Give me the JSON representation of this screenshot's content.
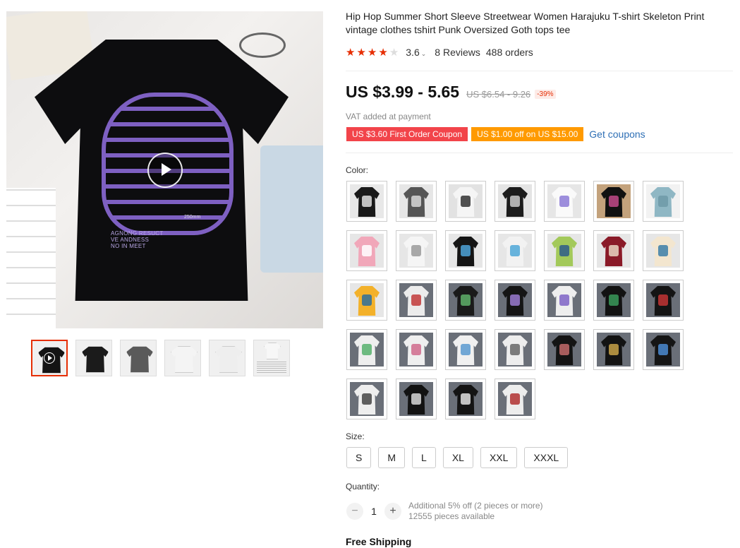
{
  "product": {
    "title": "Hip Hop Summer Short Sleeve Streetwear Women Harajuku T-shirt Skeleton Print vintage clothes tshirt Punk Oversized Goth tops tee",
    "rating": 3.6,
    "rating_text": "3.6",
    "stars_filled": 4,
    "stars_total": 5,
    "reviews": "8 Reviews",
    "orders": "488 orders"
  },
  "gallery": {
    "main_print_text": "AGNONG RESUCT\nVE ANDNESS\nNO IN MEET",
    "main_print_size": "250mm",
    "thumbnails": [
      {
        "color": "#141414",
        "has_video": true,
        "active": true
      },
      {
        "color": "#1b1b1b",
        "has_video": false,
        "active": false
      },
      {
        "color": "#5a5a5a",
        "has_video": false,
        "active": false
      },
      {
        "color": "#f4f4f4",
        "has_video": false,
        "active": false
      },
      {
        "color": "#eeeeee",
        "has_video": false,
        "active": false
      },
      {
        "color": "#f7f7f7",
        "has_video": false,
        "active": false,
        "is_size_chart": true
      }
    ]
  },
  "price": {
    "current": "US $3.99 - 5.65",
    "original": "US $6.54 - 9.26",
    "discount": "-39%",
    "vat_note": "VAT added at payment"
  },
  "coupons": {
    "first_order": "US $3.60 First Order Coupon",
    "store": "US $1.00 off on US $15.00",
    "get_coupons": "Get coupons"
  },
  "color": {
    "label": "Color:",
    "swatches": [
      {
        "shirt": "#1a1a1a",
        "print": "#e0e0e0",
        "bg": "#e8e8e8"
      },
      {
        "shirt": "#555555",
        "print": "#d8d8d8",
        "bg": "#e6e6e6"
      },
      {
        "shirt": "#f5f5f5",
        "print": "#333333",
        "bg": "#e2e2e2"
      },
      {
        "shirt": "#1c1c1c",
        "print": "#c9c9c9",
        "bg": "#e4e4e4"
      },
      {
        "shirt": "#fafafa",
        "print": "#8c7ad6",
        "bg": "#e6e6e6"
      },
      {
        "shirt": "#111111",
        "print": "#c24a8a",
        "bg": "#c3a27c"
      },
      {
        "shirt": "#8fb7c4",
        "print": "#6f9aa8",
        "bg": "#f2f2f2"
      },
      {
        "shirt": "#f1a7b9",
        "print": "#ffffff",
        "bg": "#e6e6e6"
      },
      {
        "shirt": "#f5f5f5",
        "print": "#9a9a9a",
        "bg": "#e6e6e6"
      },
      {
        "shirt": "#151515",
        "print": "#4da3d8",
        "bg": "#e6e6e6"
      },
      {
        "shirt": "#f2f2f2",
        "print": "#4fa8d8",
        "bg": "#e6e6e6"
      },
      {
        "shirt": "#a3c95a",
        "print": "#2e5c8a",
        "bg": "#e6e6e6"
      },
      {
        "shirt": "#8a1a28",
        "print": "#e9d6c2",
        "bg": "#e6e6e6"
      },
      {
        "shirt": "#f3e6cf",
        "print": "#3b7ea8",
        "bg": "#e6e6e6"
      },
      {
        "shirt": "#f3b12a",
        "print": "#2d6e9c",
        "bg": "#e6e6e6"
      },
      {
        "shirt": "#ececec",
        "print": "#c23a3a",
        "bg": "#6a6f78"
      },
      {
        "shirt": "#1a1a1a",
        "print": "#5fb06a",
        "bg": "#6a6f78"
      },
      {
        "shirt": "#151515",
        "print": "#9a7ad0",
        "bg": "#6a6f78"
      },
      {
        "shirt": "#eeeeee",
        "print": "#7e63c6",
        "bg": "#6a6f78"
      },
      {
        "shirt": "#121212",
        "print": "#3a9a5a",
        "bg": "#6a6f78"
      },
      {
        "shirt": "#141414",
        "print": "#c23434",
        "bg": "#6a6f78"
      },
      {
        "shirt": "#eeeeee",
        "print": "#56b06c",
        "bg": "#6a6f78"
      },
      {
        "shirt": "#efefef",
        "print": "#d06a8c",
        "bg": "#6a6f78"
      },
      {
        "shirt": "#f0f0f0",
        "print": "#5a9ad0",
        "bg": "#6a6f78"
      },
      {
        "shirt": "#ededed",
        "print": "#666666",
        "bg": "#6a6f78"
      },
      {
        "shirt": "#141414",
        "print": "#c26a6a",
        "bg": "#6a6f78"
      },
      {
        "shirt": "#131313",
        "print": "#c8a248",
        "bg": "#6a6f78"
      },
      {
        "shirt": "#151515",
        "print": "#4a8ad0",
        "bg": "#6a6f78"
      },
      {
        "shirt": "#eeeeee",
        "print": "#444444",
        "bg": "#6a6f78"
      },
      {
        "shirt": "#121212",
        "print": "#d8d8d8",
        "bg": "#6a6f78"
      },
      {
        "shirt": "#141414",
        "print": "#e0e0e0",
        "bg": "#6a6f78"
      },
      {
        "shirt": "#ededed",
        "print": "#b03030",
        "bg": "#6a6f78"
      }
    ]
  },
  "size": {
    "label": "Size:",
    "options": [
      "S",
      "M",
      "L",
      "XL",
      "XXL",
      "XXXL"
    ]
  },
  "quantity": {
    "label": "Quantity:",
    "value": "1",
    "minus": "−",
    "plus": "+",
    "discount_note": "Additional 5% off (2 pieces or more)",
    "available": "12555 pieces available"
  },
  "shipping": {
    "label": "Free Shipping"
  }
}
